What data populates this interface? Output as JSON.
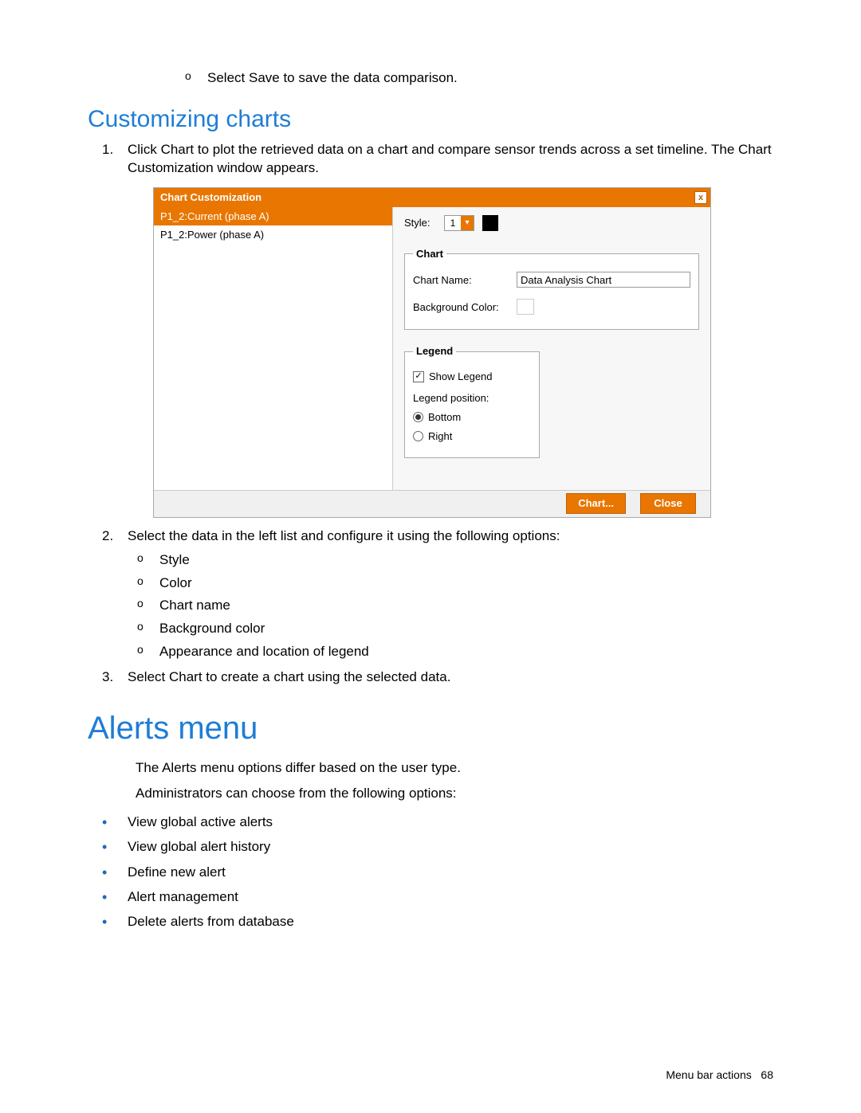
{
  "top_bullet": {
    "pre": "Select ",
    "strong": "Save",
    "post": " to save the data comparison."
  },
  "h2": "Customizing charts",
  "step1": {
    "num": "1.",
    "pre": "Click ",
    "strong": "Chart",
    "post": " to plot the retrieved data on a chart and compare sensor trends across a set timeline. The Chart Customization window appears."
  },
  "window": {
    "title": "Chart Customization",
    "close_glyph": "x",
    "list": {
      "item_selected": "P1_2:Current (phase A)",
      "item_2": "P1_2:Power (phase A)"
    },
    "style_label": "Style:",
    "style_value": "1",
    "arrow_glyph": "▾",
    "chart_group": {
      "legend": "Chart",
      "name_label": "Chart Name:",
      "name_value": "Data Analysis Chart",
      "bg_label": "Background Color:"
    },
    "legend_group": {
      "legend": "Legend",
      "show": "Show Legend",
      "pos_label": "Legend position:",
      "opt_bottom": "Bottom",
      "opt_right": "Right"
    },
    "btn_chart": "Chart...",
    "btn_close": "Close"
  },
  "step2": {
    "num": "2.",
    "text": "Select the data in the left list and configure it using the following options:",
    "opts": {
      "a": "Style",
      "b": "Color",
      "c": "Chart name",
      "d": "Background color",
      "e": "Appearance and location of legend"
    }
  },
  "step3": {
    "num": "3.",
    "pre": "Select ",
    "strong": "Chart",
    "post": " to create a chart using the selected data."
  },
  "h1": "Alerts menu",
  "p1": "The Alerts menu options differ based on the user type.",
  "p2": "Administrators can choose from the following options:",
  "admin_opts": {
    "a": "View global active alerts",
    "b": "View global alert history",
    "c": "Define new alert",
    "d": "Alert management",
    "e": "Delete alerts from database"
  },
  "footer": {
    "section": "Menu bar actions",
    "page": "68"
  }
}
